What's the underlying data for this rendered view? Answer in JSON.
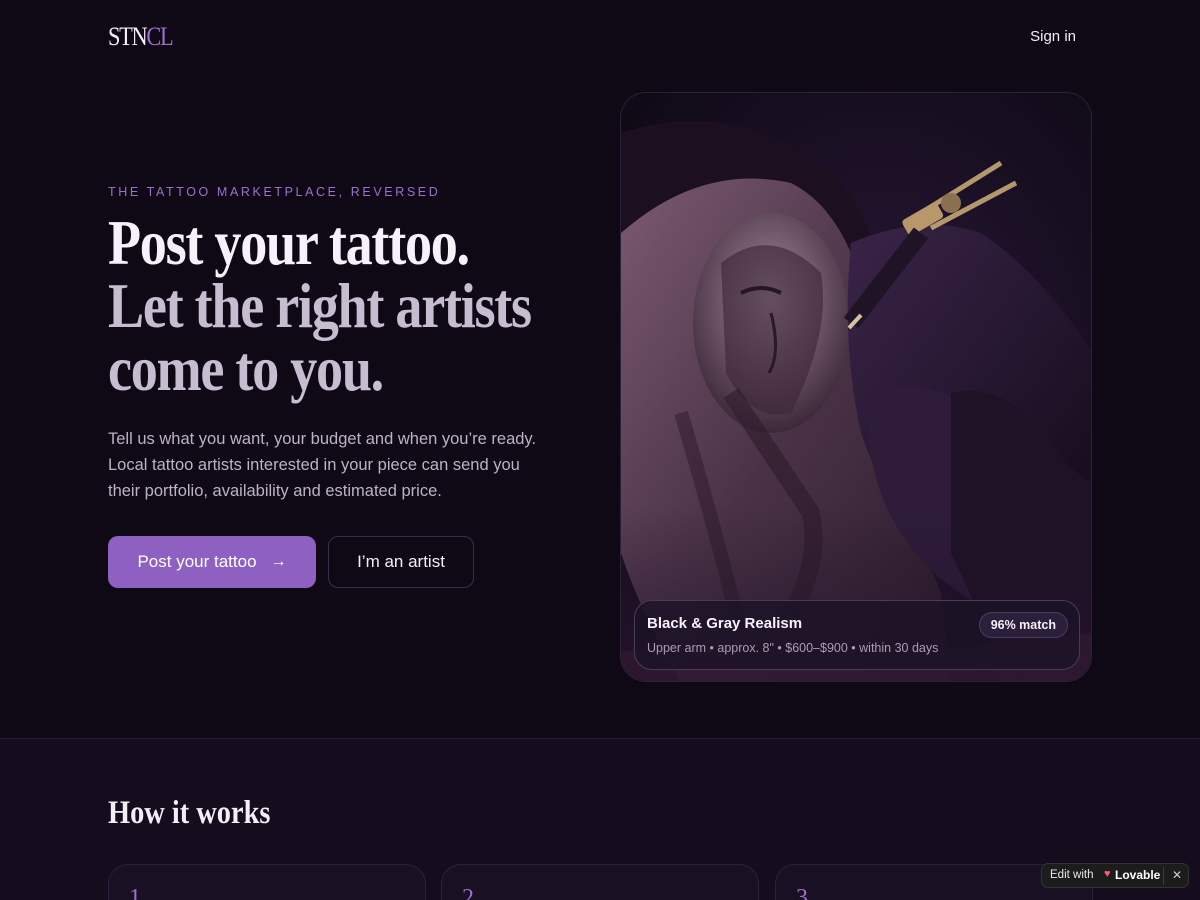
{
  "nav": {
    "logo_part1": "STN",
    "logo_part2": "CL",
    "signin_label": "Sign in"
  },
  "hero": {
    "eyebrow": "THE TATTOO MARKETPLACE, REVERSED",
    "headline_line1": "Post your tattoo.",
    "headline_line2": "Let the right artists",
    "headline_line3": "come to you.",
    "lead": "Tell us what you want, your budget and when you’re ready. Local tattoo artists interested in your piece can send you their portfolio, availability and estimated price.",
    "primary_button": "Post your tattoo",
    "primary_button_icon": "arrow-right-icon",
    "secondary_button": "I’m an artist"
  },
  "match_card": {
    "title": "Black & Gray Realism",
    "meta": "Upper arm • approx. 8\" • $600–$900 • within 30 days",
    "badge": "96% match"
  },
  "how_it_works": {
    "title": "How it works",
    "steps": [
      "1",
      "2",
      "3"
    ]
  },
  "lovable_badge": {
    "edit_label": "Edit with",
    "brand": "Lovable",
    "close": "✕"
  },
  "colors": {
    "background": "#0f0916",
    "accent": "#8e60c2",
    "eyebrow": "#9b6fd0"
  }
}
